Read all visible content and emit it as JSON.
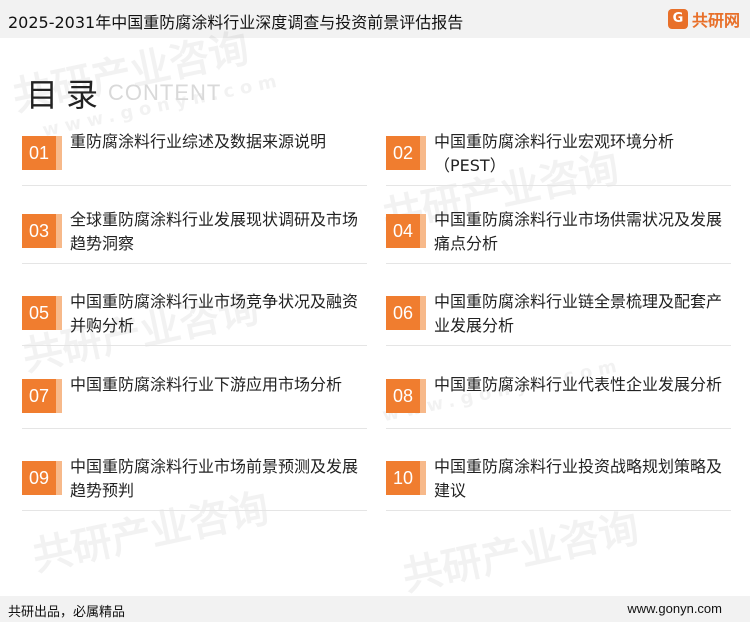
{
  "header": {
    "title": "2025-2031年中国重防腐涂料行业深度调查与投资前景评估报告",
    "brand_mark": "G",
    "brand_name": "共研网"
  },
  "toc": {
    "title": "目录",
    "subtitle": "CONTENT"
  },
  "watermark": {
    "text": "共研产业咨询",
    "url": "www.gonyn.com"
  },
  "items": [
    {
      "num": "01",
      "label": "重防腐涂料行业综述及数据来源说明"
    },
    {
      "num": "02",
      "label": "中国重防腐涂料行业宏观环境分析（PEST）"
    },
    {
      "num": "03",
      "label": "全球重防腐涂料行业发展现状调研及市场趋势洞察"
    },
    {
      "num": "04",
      "label": "中国重防腐涂料行业市场供需状况及发展痛点分析"
    },
    {
      "num": "05",
      "label": "中国重防腐涂料行业市场竞争状况及融资并购分析"
    },
    {
      "num": "06",
      "label": "中国重防腐涂料行业链全景梳理及配套产业发展分析"
    },
    {
      "num": "07",
      "label": "中国重防腐涂料行业下游应用市场分析"
    },
    {
      "num": "08",
      "label": "中国重防腐涂料行业代表性企业发展分析"
    },
    {
      "num": "09",
      "label": "中国重防腐涂料行业市场前景预测及发展趋势预判"
    },
    {
      "num": "10",
      "label": "中国重防腐涂料行业投资战略规划策略及建议"
    }
  ],
  "footer": {
    "slogan": "共研出品，必属精品",
    "site": "www.gonyn.com"
  },
  "colors": {
    "accent": "#f07d2f",
    "accent_light": "#f7b98a"
  }
}
